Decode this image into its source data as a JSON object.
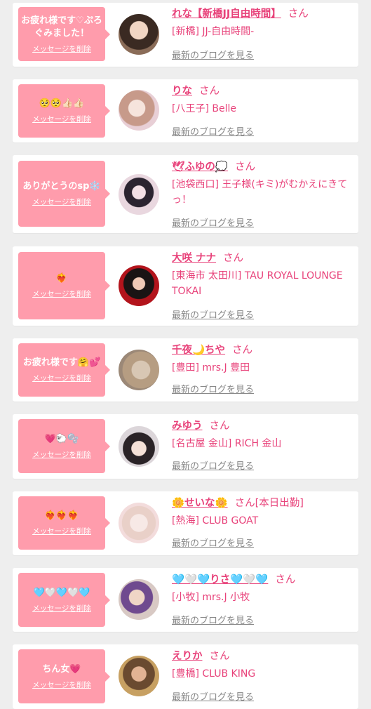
{
  "labels": {
    "delete": "メッセージを削除",
    "blog": "最新のブログを見る"
  },
  "colors": {
    "accent": "#e8427a",
    "bubble": "#ff9cac",
    "background": "#eeeeee"
  },
  "entries": [
    {
      "message": "お疲れ様です♡ぷろぐみました！",
      "name": "れな【新橋JJ自由時間】",
      "suffix": "さん",
      "shop": "[新橋] JJ-自由時間-"
    },
    {
      "message": "🥺🥺👍🏻👍🏻",
      "name": "りな",
      "suffix": "さん",
      "shop": "[八王子] Belle"
    },
    {
      "message": "ありがとうのsp❄️",
      "name": "🕊ふゆの💭",
      "suffix": "さん",
      "shop": "[池袋西口] 王子様(キミ)がむかえにきてっ！"
    },
    {
      "message": "❤️‍🔥",
      "name": "大咲 ナナ",
      "suffix": "さん",
      "shop": "[東海市 太田川] TAU ROYAL LOUNGE TOKAI"
    },
    {
      "message": "お疲れ様です🤗💕",
      "name": "千夜🌙ちや",
      "suffix": "さん",
      "shop": "[豊田] mrs.J 豊田"
    },
    {
      "message": "💗🐑🫧",
      "name": "みゆう",
      "suffix": "さん",
      "shop": "[名古屋 金山] RICH 金山"
    },
    {
      "message": "❤️‍🔥❤️‍🔥❤️‍🔥",
      "name": "🌼せいな🌼",
      "suffix": "さん[本日出勤]",
      "shop": "[熱海] CLUB GOAT"
    },
    {
      "message": "🩵🤍🩵🤍🩵",
      "name": "🩵🤍🩵りさ🩵🤍🩵",
      "suffix": "さん",
      "shop": "[小牧] mrs.J 小牧"
    },
    {
      "message": "ちん女💗",
      "name": "えりか",
      "suffix": "さん",
      "shop": "[豊橋] CLUB KING"
    }
  ]
}
